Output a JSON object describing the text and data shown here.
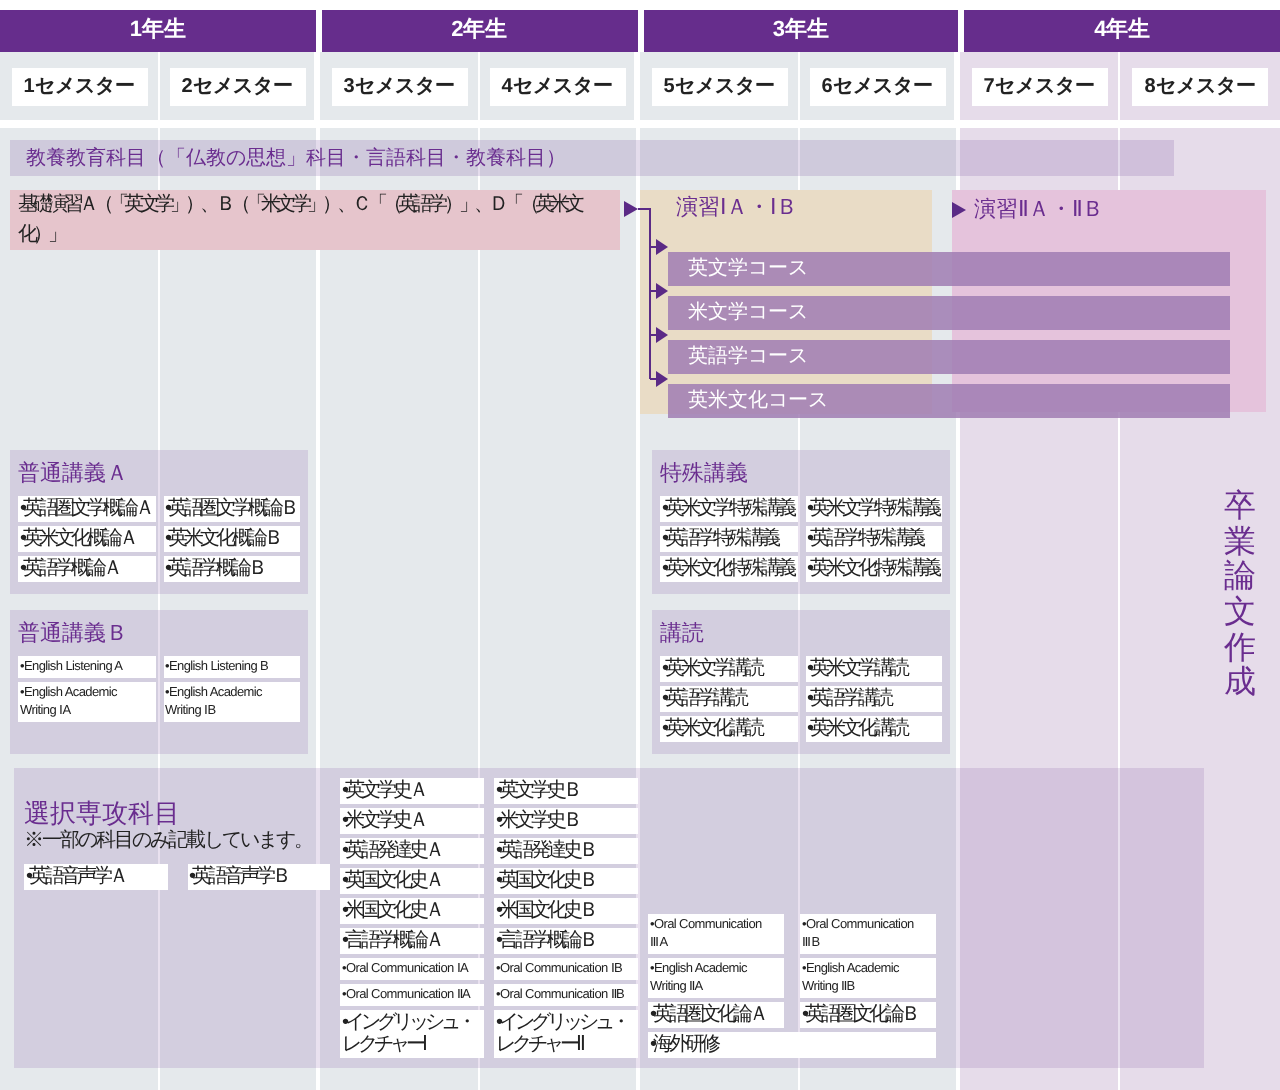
{
  "years": [
    {
      "label": "1年生",
      "color": "#e5e9ec",
      "semesters": [
        "1セメスター",
        "2セメスター"
      ]
    },
    {
      "label": "2年生",
      "color": "#e5e9ec",
      "semesters": [
        "3セメスター",
        "4セメスター"
      ]
    },
    {
      "label": "3年生",
      "color": "#e5e9ec",
      "semesters": [
        "5セメスター",
        "6セメスター"
      ]
    },
    {
      "label": "4年生",
      "color": "#e6dcea",
      "semesters": [
        "7セメスター",
        "8セメスター"
      ]
    }
  ],
  "general_education": "教養教育科目（「仏教の思想」科目・言語科目・教養科目）",
  "basic_seminar": "基礎演習Ａ（「英文学」）、Ｂ（「米文学」）、Ｃ「（英語学）」、Ｄ「（英米文化）」",
  "seminars": [
    {
      "title": "演習ⅠＡ・ⅠＢ"
    },
    {
      "title": "演習ⅡＡ・ⅡＢ"
    }
  ],
  "courses": [
    "英文学コース",
    "米文学コース",
    "英語学コース",
    "英米文化コース"
  ],
  "lecture_groups": [
    {
      "title": "普通講義Ａ",
      "items": [
        "•英語圏文学概論Ａ",
        "•英語圏文学概論Ｂ",
        "•英米文化概論Ａ",
        "•英米文化概論Ｂ",
        "•英語学概論Ａ",
        "•英語学概論Ｂ"
      ]
    },
    {
      "title": "普通講義Ｂ",
      "items": [
        "•English Listening A",
        "•English Listening B",
        "•English Academic Writing ⅠA",
        "•English Academic Writing ⅠB"
      ]
    },
    {
      "title": "特殊講義",
      "items": [
        "•英米文学特殊講義",
        "•英米文学特殊講義",
        "•英語学特殊講義",
        "•英語学特殊講義",
        "•英米文化特殊講義",
        "•英米文化特殊講義"
      ]
    },
    {
      "title": "講読",
      "items": [
        "•英米文学講読",
        "•英米文学講読",
        "•英語学講読",
        "•英語学講読",
        "•英米文化講読",
        "•英米文化講読"
      ]
    }
  ],
  "thesis": "卒業論文作成",
  "electives": {
    "title": "選択専攻科目",
    "note": "※一部の科目のみ記載しています。",
    "columns": [
      [
        "•英語音声学Ａ"
      ],
      [
        "•英語音声学Ｂ"
      ],
      [
        "•英文学史Ａ",
        "•米文学史Ａ",
        "•英語発達史Ａ",
        "•英国文化史Ａ",
        "•米国文化史Ａ",
        "•言語学概論Ａ",
        "•Oral Communication ⅠA",
        "•Oral Communication ⅡA",
        "•イングリッシュ・レクチャーⅠ"
      ],
      [
        "•英文学史Ｂ",
        "•米文学史Ｂ",
        "•英語発達史Ｂ",
        "•英国文化史Ｂ",
        "•米国文化史Ｂ",
        "•言語学概論Ｂ",
        "•Oral Communication ⅠB",
        "•Oral Communication ⅡB",
        "•イングリッシュ・レクチャーⅡ"
      ],
      [
        "•Oral Communication ⅢA",
        "•English Academic Writing ⅡA",
        "•英語圏文化論Ａ"
      ],
      [
        "•Oral Communication ⅢB",
        "•English Academic Writing ⅡB",
        "•英語圏文化論Ｂ"
      ]
    ],
    "wide_item": "•海外研修"
  }
}
